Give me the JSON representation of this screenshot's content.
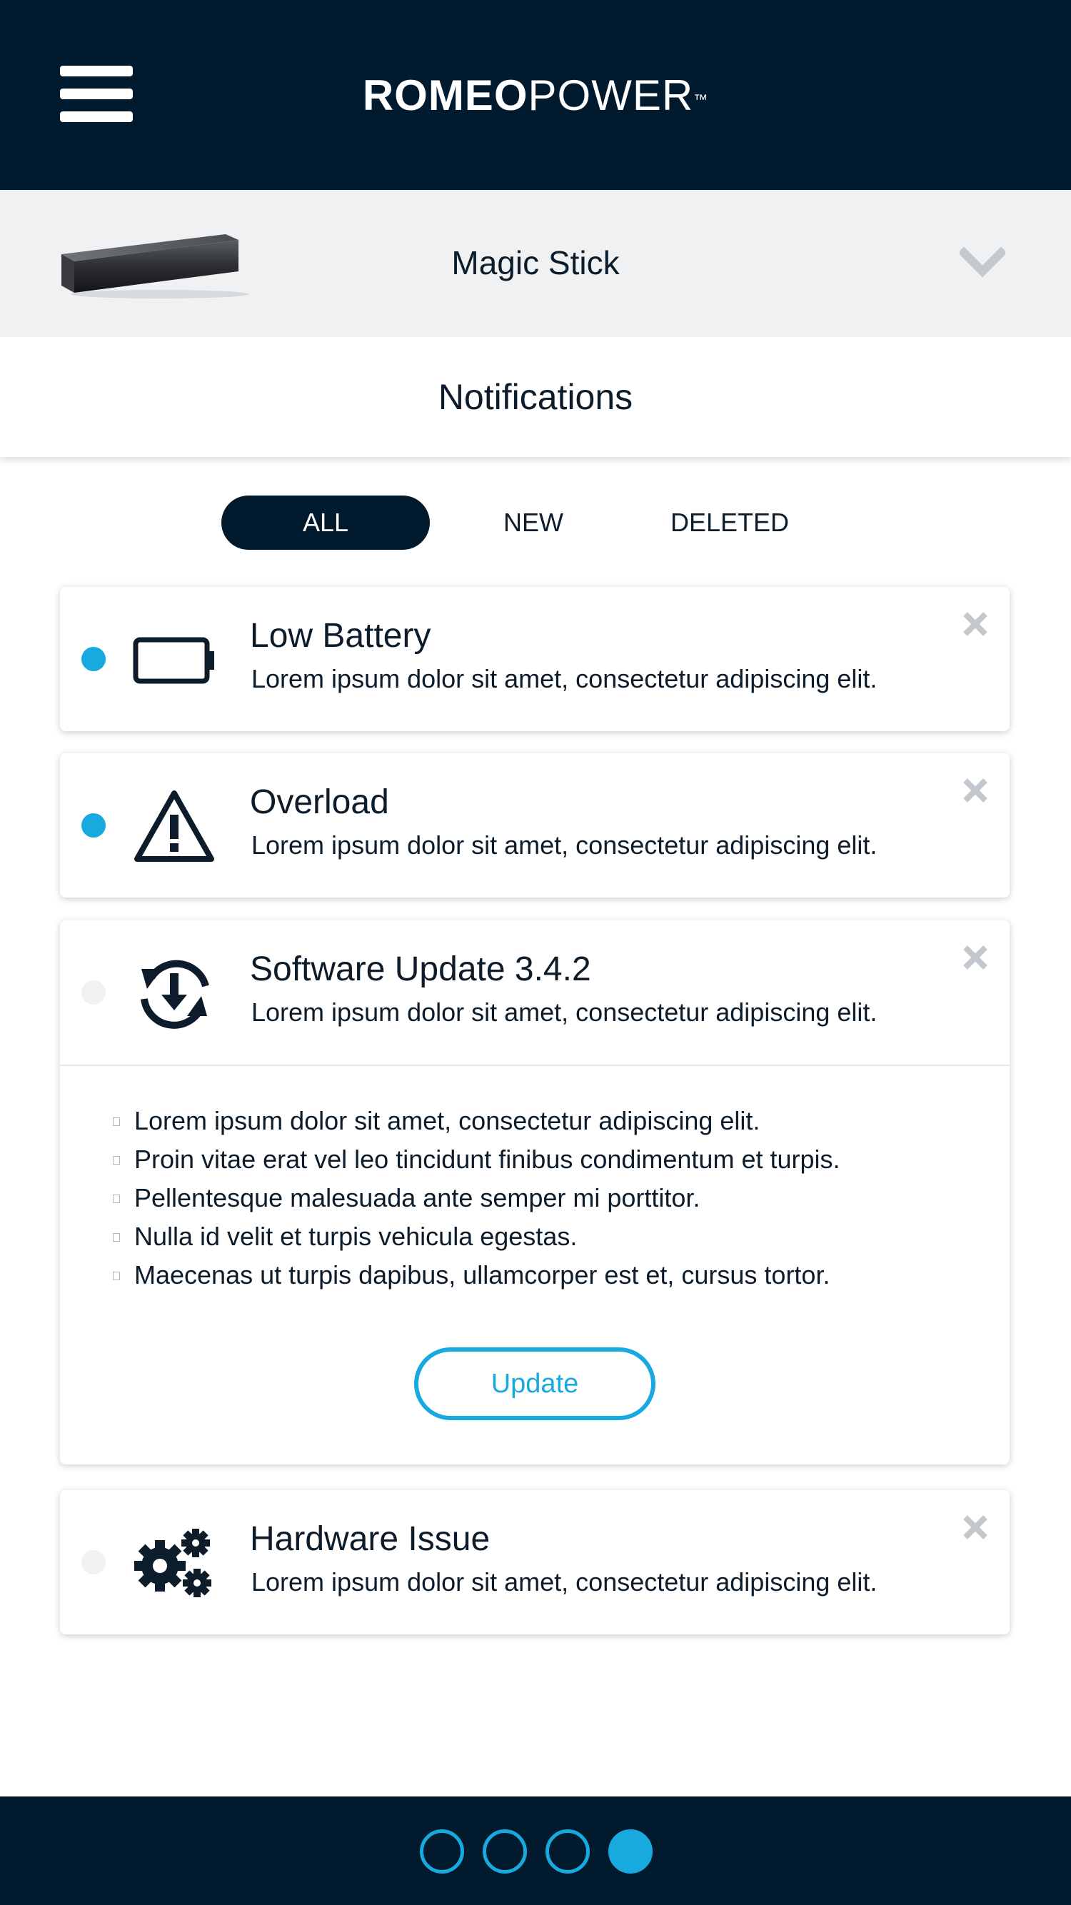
{
  "header": {
    "brand_bold": "ROMEO",
    "brand_light": "POWER",
    "brand_mark": "™"
  },
  "device": {
    "name": "Magic Stick"
  },
  "page": {
    "title": "Notifications"
  },
  "filters": {
    "tabs": [
      {
        "label": "ALL",
        "active": true
      },
      {
        "label": "NEW",
        "active": false
      },
      {
        "label": "DELETED",
        "active": false
      }
    ]
  },
  "notifications": [
    {
      "icon": "battery-icon",
      "title": "Low Battery",
      "description": "Lorem ipsum dolor sit amet, consectetur adipiscing elit.",
      "unread": true
    },
    {
      "icon": "warning-icon",
      "title": "Overload",
      "description": "Lorem ipsum dolor sit amet, consectetur adipiscing elit.",
      "unread": true
    },
    {
      "icon": "sync-download-icon",
      "title": "Software Update 3.4.2",
      "description": "Lorem ipsum dolor sit amet, consectetur adipiscing elit.",
      "unread": false,
      "details": [
        "Lorem ipsum dolor sit amet, consectetur adipiscing elit.",
        "Proin vitae erat vel leo tincidunt finibus condimentum et turpis.",
        "Pellentesque malesuada ante semper mi porttitor.",
        "Nulla id velit et turpis vehicula egestas.",
        "Maecenas ut turpis dapibus, ullamcorper est et, cursus tortor."
      ],
      "action_label": "Update"
    },
    {
      "icon": "gears-icon",
      "title": "Hardware Issue",
      "description": "Lorem ipsum dolor sit amet, consectetur adipiscing elit.",
      "unread": false
    }
  ],
  "pager": {
    "pages": 4,
    "current": 4
  },
  "colors": {
    "navy": "#021a2d",
    "accent": "#18a9df",
    "light_gray": "#eff1f3",
    "close_gray": "#c2c8ce"
  }
}
